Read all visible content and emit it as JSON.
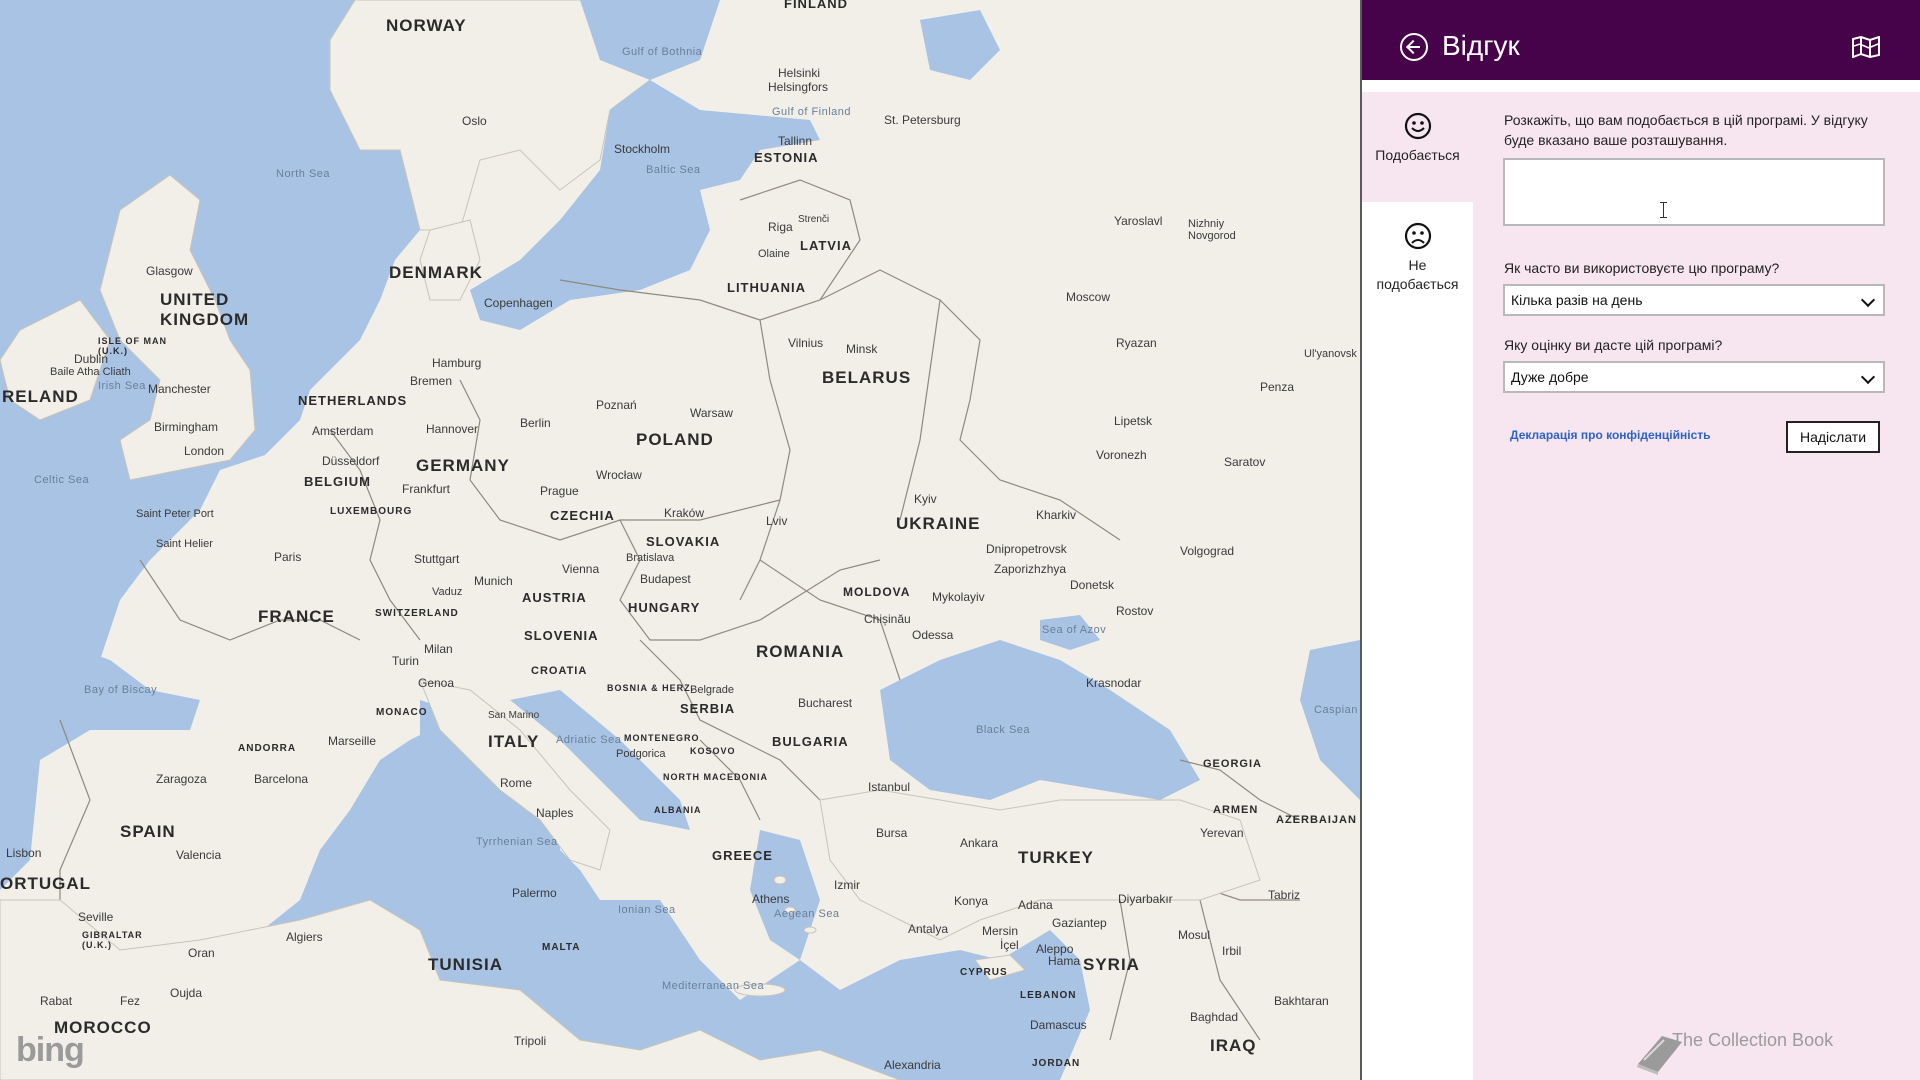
{
  "map": {
    "countries": [
      "NORWAY",
      "DENMARK",
      "UNITED KINGDOM",
      "RELAND",
      "NETHERLANDS",
      "BELGIUM",
      "LUXEMBOURG",
      "GERMANY",
      "FRANCE",
      "SWITZERLAND",
      "AUSTRIA",
      "CZECHIA",
      "SLOVAKIA",
      "HUNGARY",
      "SLOVENIA",
      "CROATIA",
      "BOSNIA & HERZ.",
      "SERBIA",
      "MONTENEGRO",
      "KOSOVO",
      "NORTH MACEDONIA",
      "ALBANIA",
      "GREECE",
      "BULGARIA",
      "ROMANIA",
      "MOLDOVA",
      "UKRAINE",
      "BELARUS",
      "POLAND",
      "LITHUANIA",
      "LATVIA",
      "ESTONIA",
      "FINLAND",
      "ITALY",
      "SPAIN",
      "ORTUGAL",
      "MONACO",
      "ANDORRA",
      "SAN MARINO",
      "TURKEY",
      "GEORGIA",
      "ARMEN",
      "AZERBAIJAN",
      "SYRIA",
      "IRAQ",
      "LEBANON",
      "CYPRUS",
      "JORDAN",
      "TUNISIA",
      "MOROCCO",
      "MALTA",
      "ISLE OF MAN (U.K.)",
      "GIBRALTAR (U.K.)"
    ],
    "cities": [
      "Oslo",
      "Stockholm",
      "Helsinki",
      "Tallinn",
      "St. Petersburg",
      "Riga",
      "Vilnius",
      "Minsk",
      "Moscow",
      "Yaroslavl",
      "Nizhniy Novgorod",
      "Ryazan",
      "Penza",
      "Lipetsk",
      "Voronezh",
      "Saratov",
      "Volgograd",
      "Rostov",
      "Krasnodar",
      "Donetsk",
      "Kharkiv",
      "Kyiv",
      "Dnipropetrovsk",
      "Zaporizhzhya",
      "Mykolayiv",
      "Odessa",
      "Chișinău",
      "Bucharest",
      "Lviv",
      "Kraków",
      "Warsaw",
      "Poznań",
      "Wrocław",
      "Prague",
      "Bratislava",
      "Vienna",
      "Budapest",
      "Munich",
      "Stuttgart",
      "Frankfurt",
      "Düsseldorf",
      "Hannover",
      "Hamburg",
      "Bremen",
      "Berlin",
      "Amsterdam",
      "Copenhagen",
      "Glasgow",
      "Dublin",
      "Manchester",
      "Birmingham",
      "London",
      "Paris",
      "Saint Peter Port",
      "Saint Helier",
      "Vaduz",
      "Milan",
      "Turin",
      "Genoa",
      "Marseille",
      "Barcelona",
      "Zaragoza",
      "Valencia",
      "Seville",
      "Lisbon",
      "Rome",
      "Naples",
      "Palermo",
      "Belgrade",
      "Podgorica",
      "Istanbul",
      "Bursa",
      "Ankara",
      "Izmir",
      "Athens",
      "Konya",
      "Adana",
      "Antalya",
      "Mersin",
      "İçel",
      "Gaziantep",
      "Aleppo",
      "Hama",
      "Damascus",
      "Diyarbakır",
      "Mosul",
      "Irbil",
      "Tabriz",
      "Yerevan",
      "Baghdad",
      "Bakhtaran",
      "Tripoli",
      "Algiers",
      "Oran",
      "Oujda",
      "Fez",
      "Rabat",
      "Alexandria",
      "Ul'yanovsk",
      "Baile Atha Cliath",
      "Strenči",
      "Olaine",
      "Helsingfors",
      "Gulf of Finland"
    ],
    "seas": [
      "North Sea",
      "Baltic Sea",
      "Gulf of Bothnia",
      "Celtic Sea",
      "Bay of Biscay",
      "Adriatic Sea",
      "Tyrrhenian Sea",
      "Ionian Sea",
      "Aegean Sea",
      "Mediterranean Sea",
      "Black Sea",
      "Sea of Azov",
      "Caspian",
      "Irish Sea"
    ],
    "attribution": "bing"
  },
  "panel": {
    "title": "Відгук",
    "tabs": {
      "like": "Подобається",
      "dislike_line1": "Не",
      "dislike_line2": "подобається"
    },
    "prompt": "Розкажіть, що вам подобається в цій програмі. У відгуку буде вказано ваше розташування.",
    "feedback_value": "",
    "q_usage": "Як часто ви використовуєте цю програму?",
    "usage_selected": "Кілька разів на день",
    "q_rating": "Яку оцінку ви дасте цій програмі?",
    "rating_selected": "Дуже добре",
    "privacy_link": "Декларація про конфіденційність",
    "send_button": "Надіслати",
    "brand": "The Collection Book"
  },
  "colors": {
    "header": "#47034a",
    "panel_bg": "#f7e6f0",
    "water": "#a9c3e4",
    "land": "#f1efe8",
    "link": "#2b63c8"
  }
}
